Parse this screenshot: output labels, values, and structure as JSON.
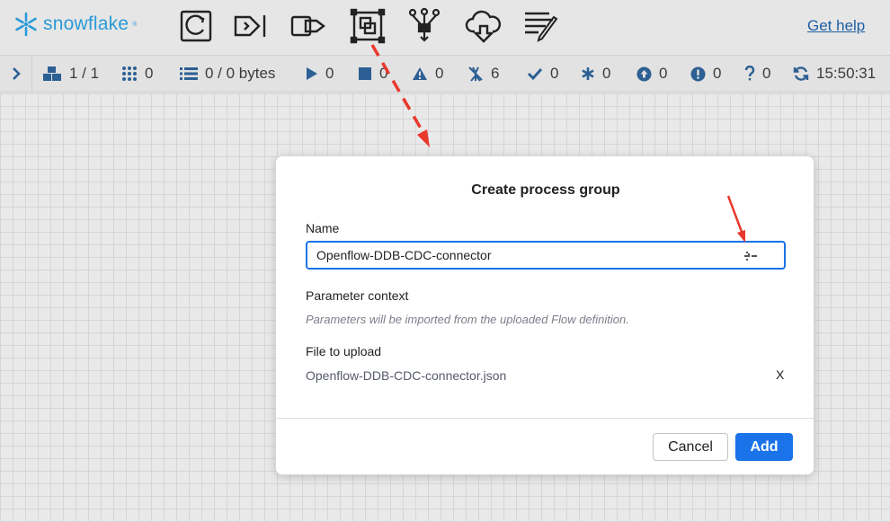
{
  "brand": {
    "name": "snowflake",
    "mark": "®"
  },
  "header": {
    "help_label": "Get help",
    "tools": [
      {
        "icon": "processor-icon"
      },
      {
        "icon": "input-port-icon"
      },
      {
        "icon": "output-port-icon"
      },
      {
        "icon": "process-group-icon"
      },
      {
        "icon": "funnel-icon"
      },
      {
        "icon": "cloud-download-icon"
      },
      {
        "icon": "label-pencil-icon"
      }
    ]
  },
  "status": {
    "items": [
      {
        "icon": "cubes-icon",
        "value": "1 / 1"
      },
      {
        "icon": "grid-dots-icon",
        "value": "0"
      },
      {
        "icon": "list-icon",
        "value": "0 / 0 bytes"
      },
      {
        "icon": "play-icon",
        "value": "0"
      },
      {
        "icon": "stop-icon",
        "value": "0"
      },
      {
        "icon": "warning-icon",
        "value": "0"
      },
      {
        "icon": "disabled-icon",
        "value": "6"
      },
      {
        "icon": "check-icon",
        "value": "0"
      },
      {
        "icon": "asterisk-icon",
        "value": "0"
      },
      {
        "icon": "arrow-up-circle-icon",
        "value": "0"
      },
      {
        "icon": "exclamation-circle-icon",
        "value": "0"
      },
      {
        "icon": "question-icon",
        "value": "0"
      },
      {
        "icon": "refresh-icon",
        "value": "15:50:31"
      }
    ]
  },
  "dialog": {
    "title": "Create process group",
    "name_label": "Name",
    "name_value": "Openflow-DDB-CDC-connector",
    "parameter_label": "Parameter context",
    "parameter_hint": "Parameters will be imported from the uploaded Flow definition.",
    "file_label": "File to upload",
    "file_name": "Openflow-DDB-CDC-connector.json",
    "remove_label": "X",
    "cancel_label": "Cancel",
    "add_label": "Add"
  },
  "colors": {
    "primary": "#1a73e8",
    "brand": "#2a9ad7",
    "link": "#1d5fa3",
    "arrow": "#e8392c",
    "status_icon": "#2c5f93"
  }
}
